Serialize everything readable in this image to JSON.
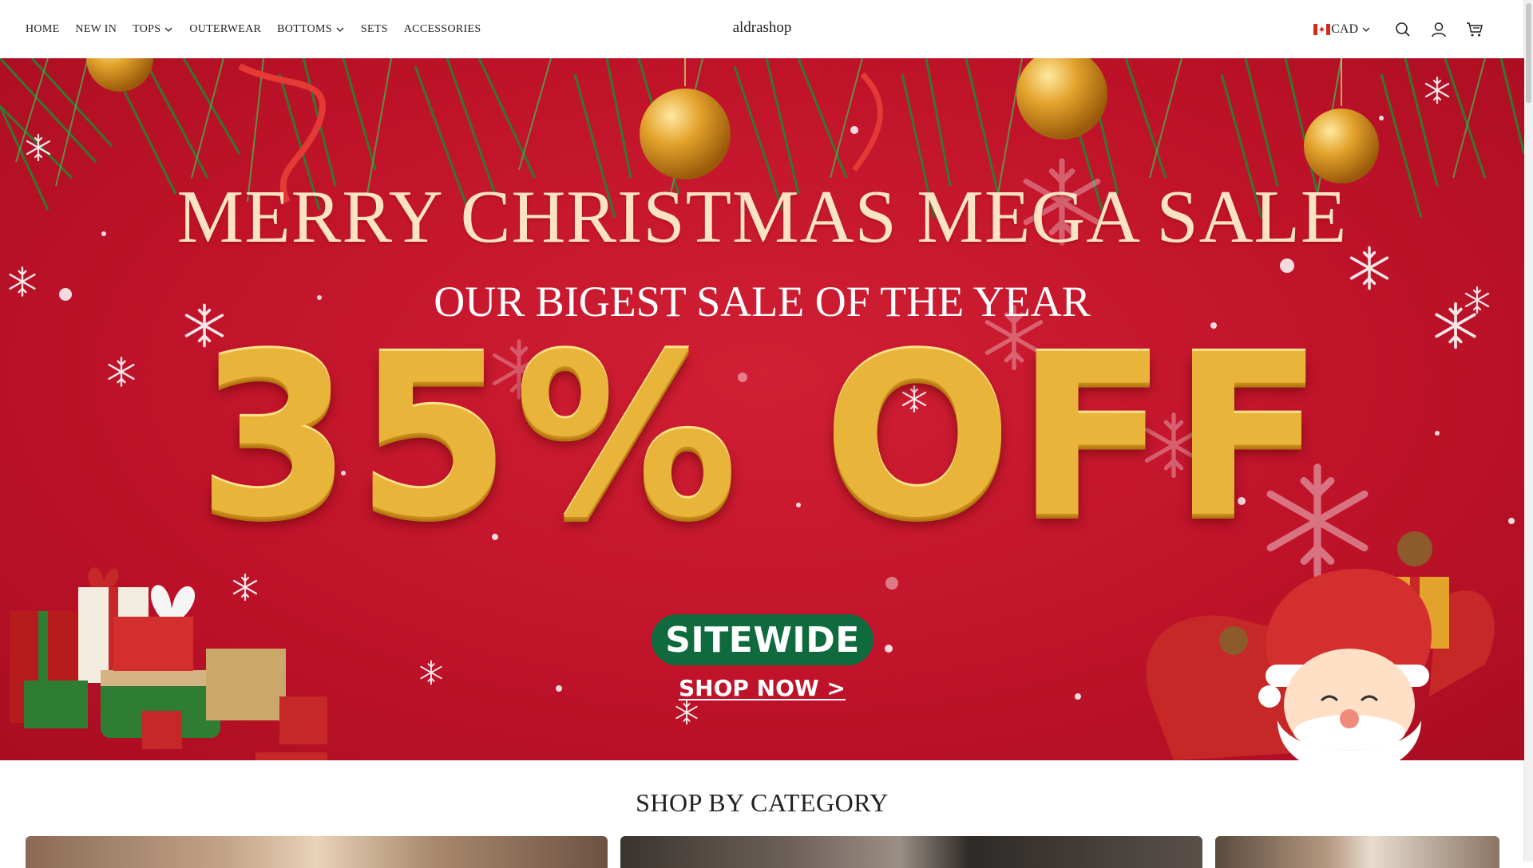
{
  "header": {
    "nav": [
      {
        "label": "HOME",
        "has_dropdown": false
      },
      {
        "label": "NEW IN",
        "has_dropdown": false
      },
      {
        "label": "TOPS",
        "has_dropdown": true
      },
      {
        "label": "OUTERWEAR",
        "has_dropdown": false
      },
      {
        "label": "BOTTOMS",
        "has_dropdown": true
      },
      {
        "label": "SETS",
        "has_dropdown": false
      },
      {
        "label": "ACCESSORIES",
        "has_dropdown": false
      }
    ],
    "logo": "aldrashop",
    "currency": "CAD",
    "icons": [
      "canada-flag-icon",
      "chevron-down-icon",
      "search-icon",
      "account-icon",
      "cart-icon"
    ]
  },
  "hero": {
    "title": "MERRY CHRISTMAS MEGA SALE",
    "subtitle": "OUR BIGEST SALE OF THE YEAR",
    "discount": "35% OFF",
    "badge": "SITEWIDE",
    "cta": "SHOP NOW >",
    "colors": {
      "background": "#c0132a",
      "title": "#fbe3c4",
      "gold": "#e8b43a",
      "badge": "#0f6b3e"
    }
  },
  "category_section": {
    "title": "SHOP BY CATEGORY"
  }
}
